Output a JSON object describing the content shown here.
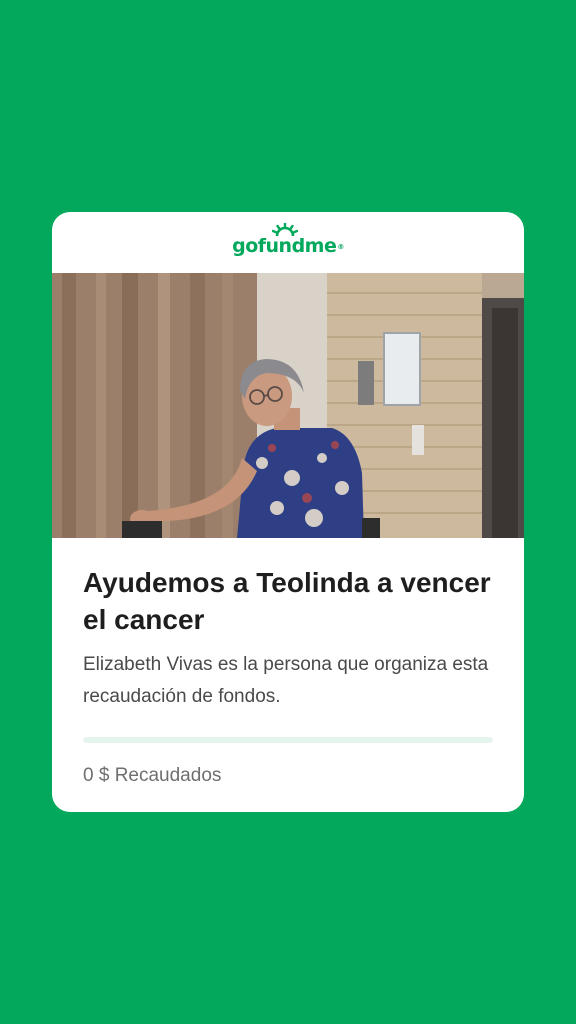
{
  "brand": {
    "name": "gofundme",
    "trademark": "®",
    "color": "#02a95c"
  },
  "campaign": {
    "title": "Ayudemos a Teolinda a vencer el cancer",
    "organizer_text": "Elizabeth Vivas es la persona que organiza esta recaudación de fondos.",
    "raised_text": "0 $ Recaudados",
    "progress_fraction": 0
  },
  "colors": {
    "background": "#02a95c",
    "card": "#ffffff",
    "progress_track": "#e6f4ee",
    "title_text": "#1e1e1e"
  }
}
